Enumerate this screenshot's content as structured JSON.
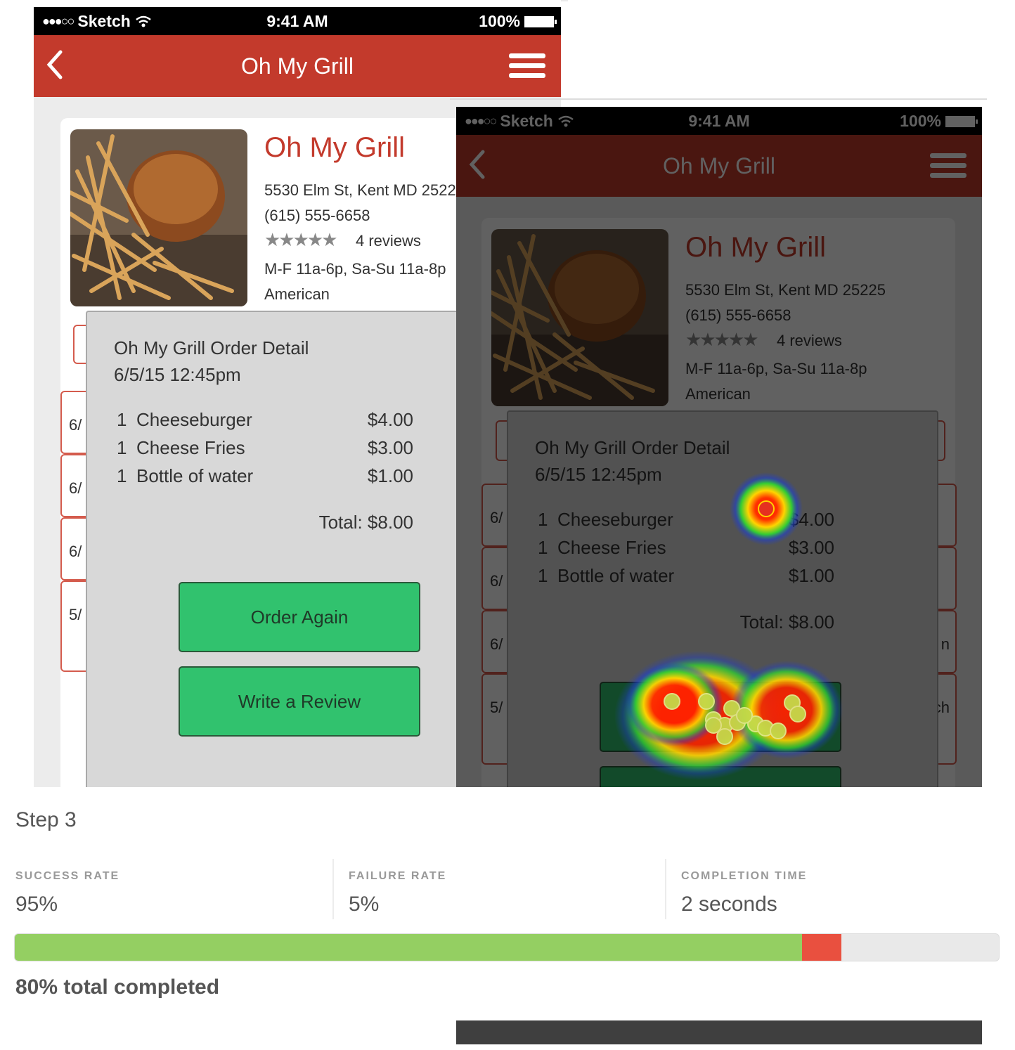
{
  "phone": {
    "carrier": "Sketch",
    "signal_dots": "●●●○○",
    "time": "9:41 AM",
    "battery": "100%",
    "nav_title": "Oh My Grill",
    "back_icon": "chevron-left-icon",
    "menu_icon": "hamburger-icon"
  },
  "restaurant": {
    "name": "Oh My Grill",
    "address": "5530 Elm St, Kent MD 25225",
    "phone": "(615) 555-6658",
    "stars": "★★★★★",
    "rating_value": 4.5,
    "reviews": "4 reviews",
    "hours": "M-F 11a-6p, Sa-Su 11a-8p",
    "cuisine": "American"
  },
  "history_rows": [
    {
      "label": "6/"
    },
    {
      "label": "6/"
    },
    {
      "label": "6/"
    },
    {
      "label": "5/"
    }
  ],
  "right_history_rows": [
    {
      "label": "6/",
      "suffix": ""
    },
    {
      "label": "6/",
      "suffix": ""
    },
    {
      "label": "6/",
      "suffix": "n"
    },
    {
      "label": "5/",
      "suffix": "ch"
    }
  ],
  "order": {
    "title": "Oh My Grill Order Detail",
    "datetime": "6/5/15 12:45pm",
    "items": [
      {
        "qty": "1",
        "name": "Cheeseburger",
        "price": "$4.00"
      },
      {
        "qty": "1",
        "name": "Cheese Fries",
        "price": "$3.00"
      },
      {
        "qty": "1",
        "name": "Bottle of water",
        "price": "$1.00"
      }
    ],
    "total": "Total: $8.00",
    "order_again": "Order Again",
    "write_review": "Write a Review"
  },
  "metrics": {
    "step": "Step 3",
    "success_label": "SUCCESS RATE",
    "success_value": "95%",
    "failure_label": "FAILURE RATE",
    "failure_value": "5%",
    "time_label": "COMPLETION TIME",
    "time_value": "2 seconds",
    "progress_success_percent": 80,
    "progress_failure_percent": 4,
    "total_completed": "80% total completed"
  },
  "colors": {
    "brand_red": "#c33a2c",
    "button_green": "#31c26e",
    "success_green": "#94cf62",
    "failure_red": "#e9503f"
  }
}
